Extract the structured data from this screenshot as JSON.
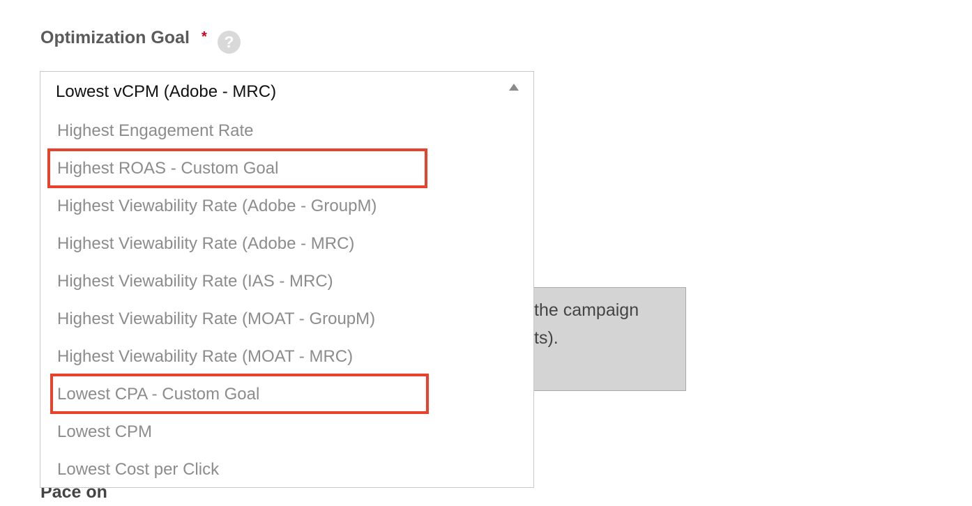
{
  "field": {
    "label": "Optimization Goal",
    "required_mark": "*",
    "help_icon": "question-mark-icon",
    "help_glyph": "?"
  },
  "select": {
    "value": "Lowest vCPM (Adobe - MRC)",
    "caret_icon": "caret-up-icon"
  },
  "options": [
    "Highest Engagement Rate",
    "Highest ROAS - Custom Goal",
    "Highest Viewability Rate (Adobe - GroupM)",
    "Highest Viewability Rate (Adobe - MRC)",
    "Highest Viewability Rate (IAS - MRC)",
    "Highest Viewability Rate (MOAT - GroupM)",
    "Highest Viewability Rate (MOAT - MRC)",
    "Lowest CPA - Custom Goal",
    "Lowest CPM",
    "Lowest Cost per Click"
  ],
  "background": {
    "info_line_1": "the campaign",
    "info_line_2": "ts).",
    "pace_label": "Pace on"
  },
  "colors": {
    "highlight": "#e8412c",
    "required": "#d0021b",
    "option_text": "#8c8c8c"
  }
}
